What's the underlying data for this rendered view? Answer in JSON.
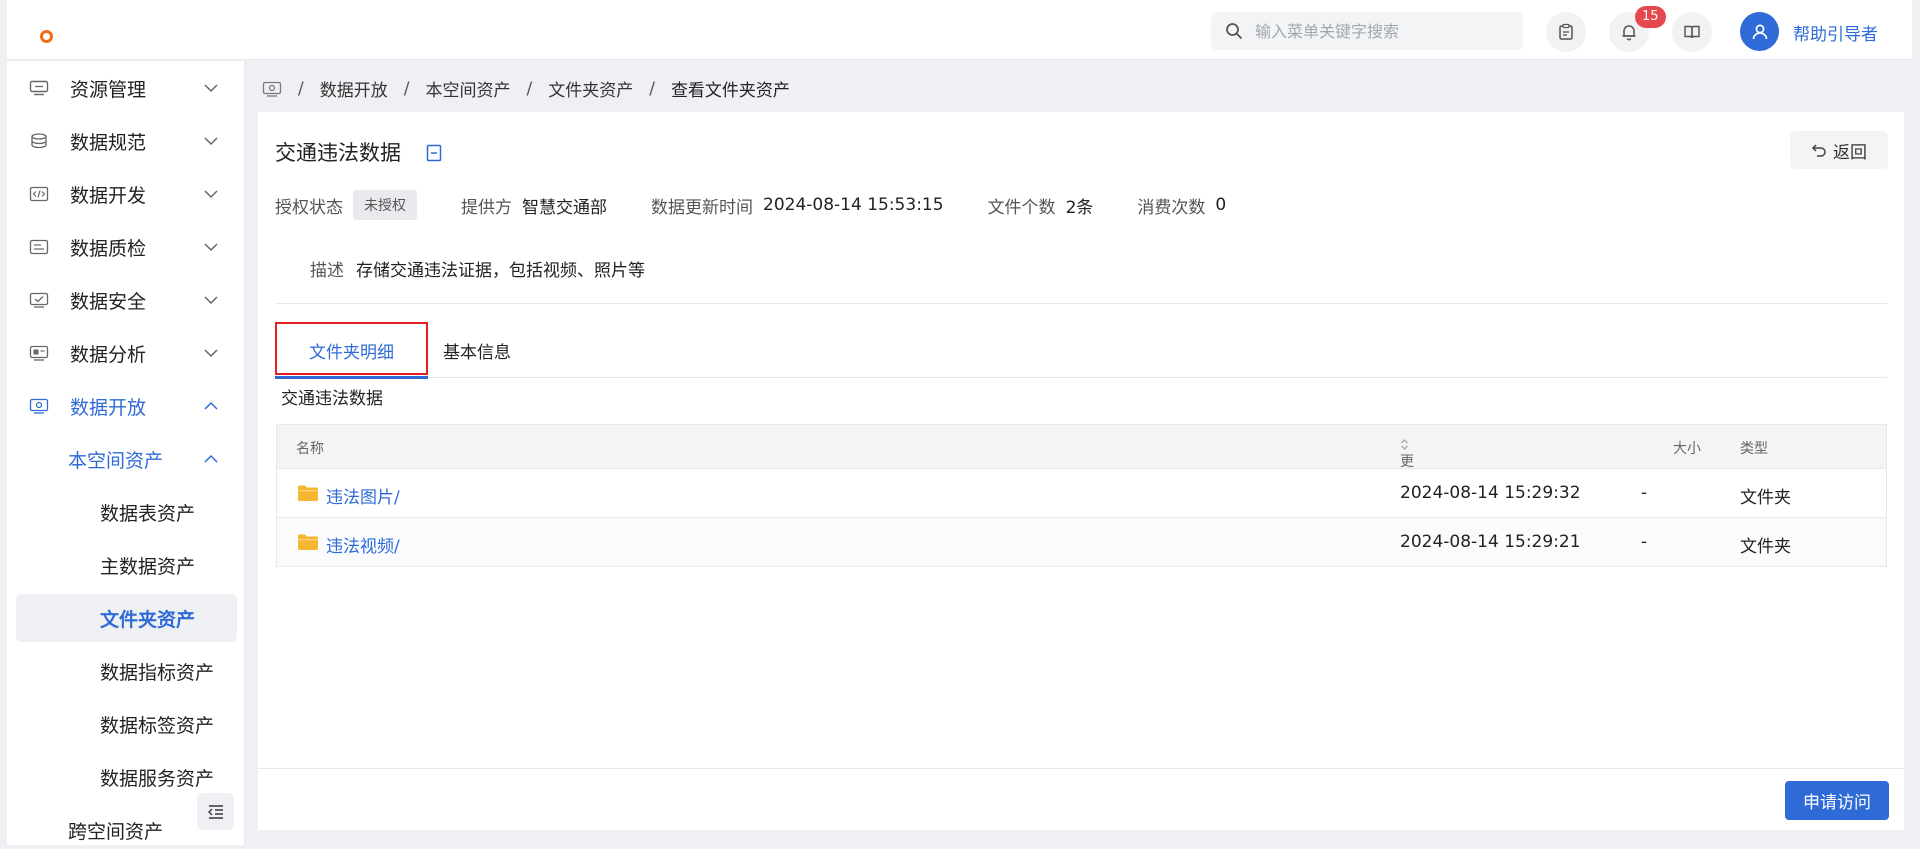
{
  "header": {
    "search_placeholder": "输入菜单关键字搜索",
    "notification_count": "15",
    "username": "帮助引导者",
    "accent_color": "#2f6bd7"
  },
  "sidebar": {
    "items": [
      {
        "label": "资源管理",
        "icon": "server-icon"
      },
      {
        "label": "数据规范",
        "icon": "database-icon"
      },
      {
        "label": "数据开发",
        "icon": "code-icon"
      },
      {
        "label": "数据质检",
        "icon": "inspect-icon"
      },
      {
        "label": "数据安全",
        "icon": "shield-check-icon"
      },
      {
        "label": "数据分析",
        "icon": "analysis-icon"
      },
      {
        "label": "数据开放",
        "icon": "open-data-icon"
      }
    ],
    "sub_group": "本空间资产",
    "leaves": [
      "数据表资产",
      "主数据资产",
      "文件夹资产",
      "数据指标资产",
      "数据标签资产",
      "数据服务资产"
    ],
    "next_group": "跨空间资产"
  },
  "breadcrumb": [
    "数据开放",
    "本空间资产",
    "文件夹资产",
    "查看文件夹资产"
  ],
  "detail": {
    "title": "交通违法数据",
    "back_label": "返回",
    "auth_key": "授权状态",
    "auth_value": "未授权",
    "provider_key": "提供方",
    "provider_value": "智慧交通部",
    "updated_key": "数据更新时间",
    "updated_value": "2024-08-14 15:53:15",
    "file_count_key": "文件个数",
    "file_count_value": "2条",
    "consume_key": "消费次数",
    "consume_value": "0",
    "desc_key": "描述",
    "desc_value": "存储交通违法证据，包括视频、照片等"
  },
  "tabs": [
    "文件夹明细",
    "基本信息"
  ],
  "folder_caption": "交通违法数据",
  "table": {
    "columns": [
      "名称",
      "更新时间",
      "大小",
      "类型"
    ],
    "rows": [
      {
        "name": "违法图片/",
        "updated": "2024-08-14 15:29:32",
        "size": "-",
        "type": "文件夹"
      },
      {
        "name": "违法视频/",
        "updated": "2024-08-14 15:29:21",
        "size": "-",
        "type": "文件夹"
      }
    ]
  },
  "apply_label": "申请访问"
}
